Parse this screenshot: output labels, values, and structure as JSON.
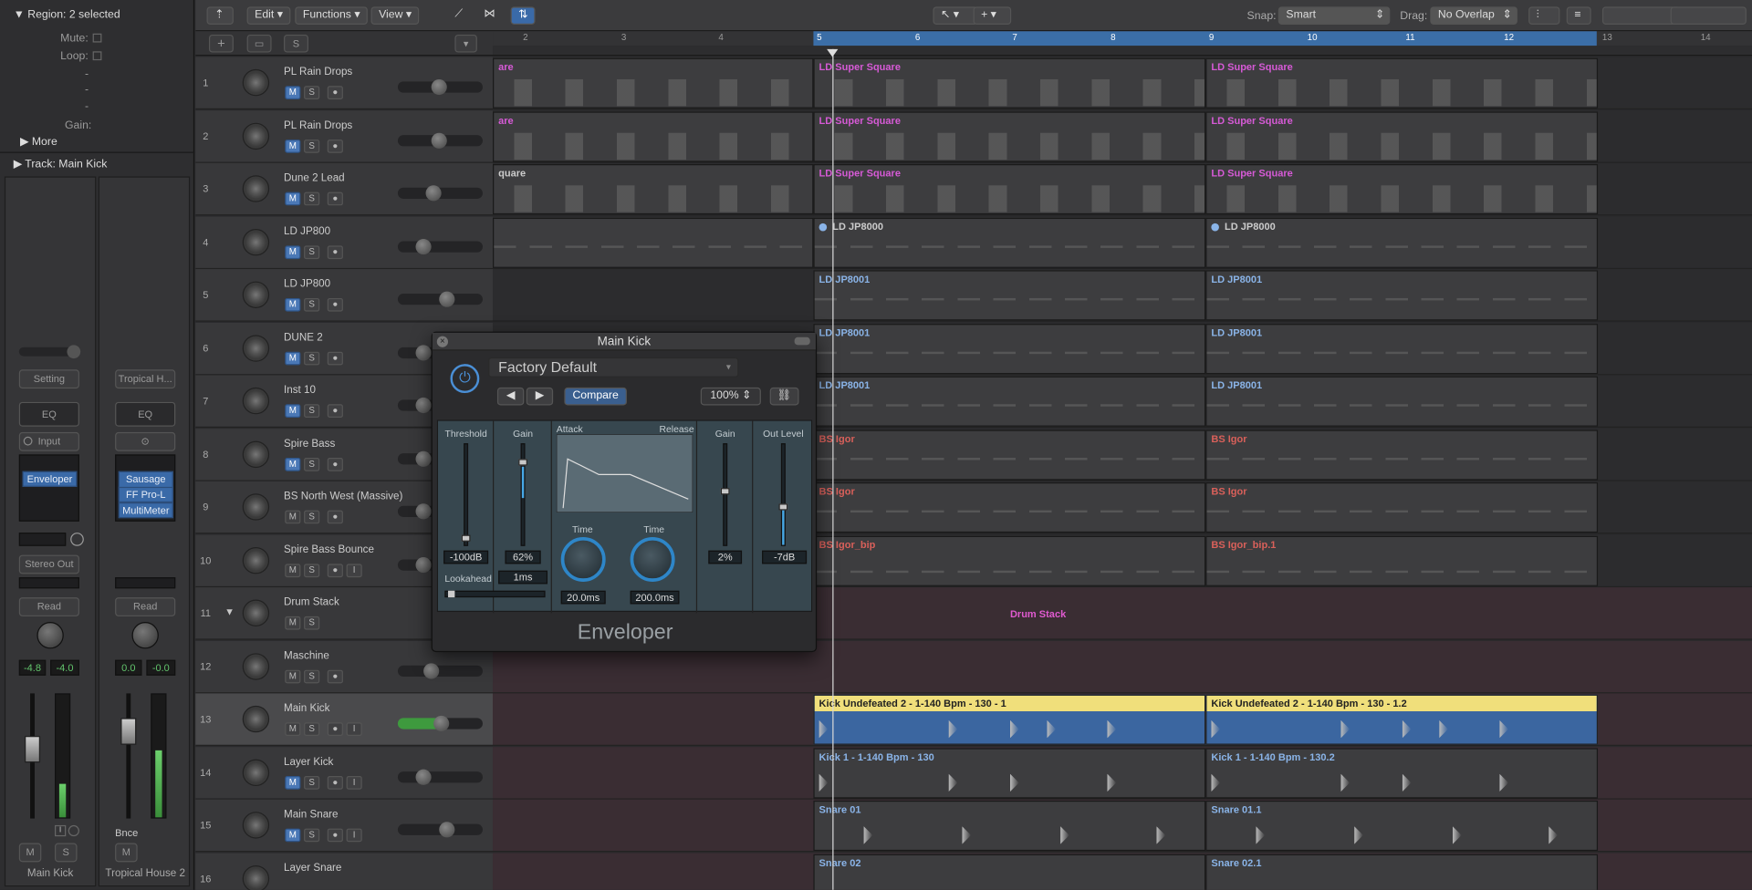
{
  "inspector": {
    "region_title": "Region: 2 selected",
    "mute": "Mute:",
    "loop": "Loop:",
    "dash1": "-",
    "dash2": "-",
    "dash3": "-",
    "gain": "Gain:",
    "more": "More",
    "track": "Track:  Main Kick",
    "strip1": {
      "setting": "Setting",
      "eq": "EQ",
      "input": "Input",
      "plugin": "Enveloper",
      "out": "Stereo Out",
      "auto": "Read",
      "pan_l": "-4.8",
      "pan_r": "-4.0",
      "m": "M",
      "s": "S",
      "name": "Main Kick"
    },
    "strip2": {
      "setting": "Tropical H...",
      "eq": "EQ",
      "plugins": [
        "Sausage Fa",
        "FF Pro-L",
        "MultiMeter"
      ],
      "auto": "Read",
      "pan_l": "0.0",
      "pan_r": "-0.0",
      "bnce": "Bnce",
      "m": "M",
      "name": "Tropical House 2"
    }
  },
  "toolbar": {
    "edit": "Edit",
    "functions": "Functions",
    "view": "View",
    "snap_label": "Snap:",
    "snap": "Smart",
    "drag_label": "Drag:",
    "drag": "No Overlap"
  },
  "ruler": [
    "2",
    "3",
    "4",
    "5",
    "6",
    "7",
    "8",
    "9",
    "10",
    "11",
    "12",
    "13",
    "14"
  ],
  "tracks": [
    {
      "n": "1",
      "name": "PL Rain Drops"
    },
    {
      "n": "2",
      "name": "PL Rain Drops"
    },
    {
      "n": "3",
      "name": "Dune 2 Lead"
    },
    {
      "n": "4",
      "name": "LD JP800"
    },
    {
      "n": "5",
      "name": "LD JP800"
    },
    {
      "n": "6",
      "name": "DUNE 2"
    },
    {
      "n": "7",
      "name": "Inst 10"
    },
    {
      "n": "8",
      "name": "Spire Bass"
    },
    {
      "n": "9",
      "name": "BS North West (Massive)"
    },
    {
      "n": "10",
      "name": "Spire Bass Bounce"
    },
    {
      "n": "11",
      "name": "Drum Stack"
    },
    {
      "n": "12",
      "name": "Maschine"
    },
    {
      "n": "13",
      "name": "Main Kick"
    },
    {
      "n": "14",
      "name": "Layer Kick"
    },
    {
      "n": "15",
      "name": "Main Snare"
    },
    {
      "n": "16",
      "name": "Layer Snare"
    }
  ],
  "regions": {
    "r1a": "are",
    "r1b": "LD Super Square",
    "r1c": "LD Super Square",
    "r2a": "are",
    "r2b": "LD Super Square",
    "r2c": "LD Super Square",
    "r3a": "quare",
    "r3b": "LD Super Square",
    "r3c": "LD Super Square",
    "r4b": "LD JP8000",
    "r4c": "LD JP8000",
    "r5b": "LD JP8001",
    "r5c": "LD JP8001",
    "r6b": "LD JP8001",
    "r6c": "LD JP8001",
    "r7b": "LD JP8001",
    "r7c": "LD JP8001",
    "r8b": "BS Igor",
    "r8c": "BS Igor",
    "r9b": "BS Igor",
    "r9c": "BS Igor",
    "r10b": "BS Igor_bip",
    "r10c": "BS Igor_bip.1",
    "drum": "Drum Stack",
    "r13b": "Kick Undefeated 2 - 1-140 Bpm - 130 - 1",
    "r13c": "Kick Undefeated 2 - 1-140 Bpm - 130 - 1.2",
    "r14b": "Kick 1 - 1-140 Bpm - 130",
    "r14c": "Kick 1 - 1-140 Bpm - 130.2",
    "r15b": "Snare 01",
    "r15c": "Snare 01.1",
    "r16b": "Snare 02",
    "r16c": "Snare 02.1"
  },
  "plugin": {
    "title": "Main Kick",
    "preset": "Factory Default",
    "compare": "Compare",
    "zoom": "100%",
    "threshold": "Threshold",
    "gain1": "Gain",
    "attack": "Attack",
    "release": "Release",
    "gain2": "Gain",
    "outlevel": "Out Level",
    "thr_val": "-100dB",
    "gain_val": "62%",
    "time1": "Time",
    "time2": "Time",
    "atk_val": "20.0ms",
    "rel_val": "200.0ms",
    "gain2_val": "2%",
    "out_val": "-7dB",
    "lookahead": "Lookahead",
    "look_val": "1ms",
    "name": "Enveloper"
  },
  "colors": {
    "midi_pink": "#d65ad6",
    "midi_red": "#d9605a",
    "blue": "#8ab4e8",
    "selected": "#f0df7b"
  }
}
